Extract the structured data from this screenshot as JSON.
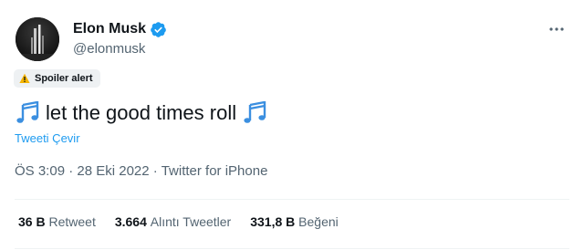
{
  "author": {
    "display_name": "Elon Musk",
    "handle": "@elonmusk",
    "verified": true
  },
  "spoiler": {
    "label": "Spoiler alert",
    "icon": "warning-icon"
  },
  "tweet": {
    "text": "let the good times roll",
    "emoji_icon": "musical-notes-icon",
    "translate_label": "Tweeti Çevir"
  },
  "meta": {
    "time": "ÖS 3:09",
    "separator": "·",
    "date": "28 Eki 2022",
    "source": "Twitter for iPhone"
  },
  "stats": {
    "retweets_value": "36 B",
    "retweets_label": "Retweet",
    "quotes_value": "3.664",
    "quotes_label": "Alıntı Tweetler",
    "likes_value": "331,8 B",
    "likes_label": "Beğeni"
  },
  "colors": {
    "accent": "#1d9bf0",
    "text": "#0f1419",
    "secondary": "#536471"
  }
}
